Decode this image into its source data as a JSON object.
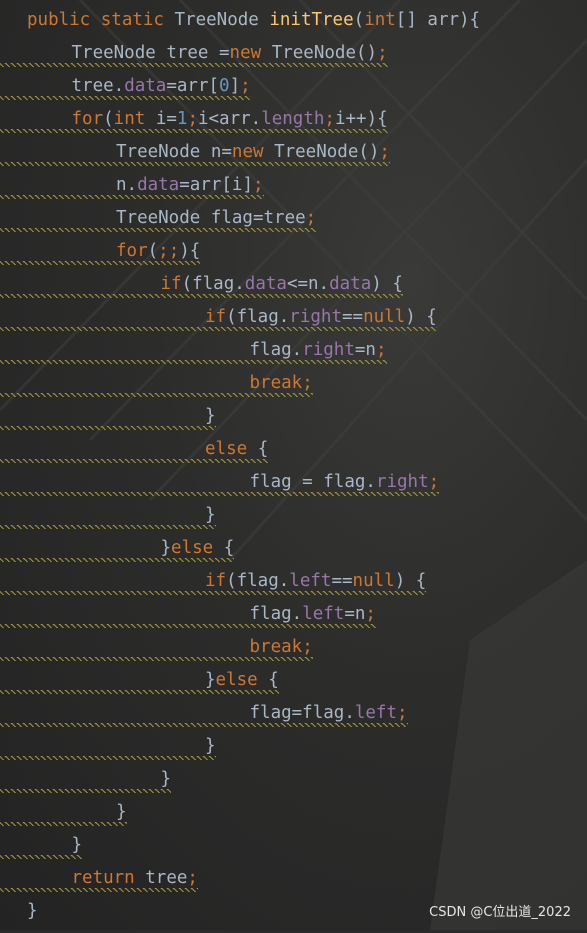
{
  "editor": {
    "colors": {
      "background": "#2b2b2b",
      "keyword": "#cc7832",
      "method": "#ffc66d",
      "field": "#9876aa",
      "number": "#6897bb",
      "text": "#a9b7c6",
      "warning_underline": "#a89a3c"
    },
    "lines": [
      {
        "indent": 0,
        "tokens": [
          [
            "public static ",
            "keyword"
          ],
          [
            "TreeNode ",
            "text"
          ],
          [
            "initTree",
            "method"
          ],
          [
            "(",
            "text"
          ],
          [
            "int",
            "keyword"
          ],
          [
            "[] arr){",
            "text"
          ]
        ]
      },
      {
        "indent": 1,
        "tokens": [
          [
            "TreeNode tree =",
            "text"
          ],
          [
            "new ",
            "keyword"
          ],
          [
            "TreeNode()",
            "text"
          ],
          [
            ";",
            "keyword"
          ]
        ]
      },
      {
        "indent": 1,
        "tokens": [
          [
            "tree.",
            "text"
          ],
          [
            "data",
            "field"
          ],
          [
            "=arr[",
            "text"
          ],
          [
            "0",
            "number"
          ],
          [
            "]",
            "text"
          ],
          [
            ";",
            "keyword"
          ]
        ]
      },
      {
        "indent": 1,
        "tokens": [
          [
            "for",
            "keyword"
          ],
          [
            "(",
            "text"
          ],
          [
            "int ",
            "keyword"
          ],
          [
            "i=",
            "text"
          ],
          [
            "1",
            "number"
          ],
          [
            ";",
            "keyword"
          ],
          [
            "i<arr.",
            "text"
          ],
          [
            "length",
            "field"
          ],
          [
            ";",
            "keyword"
          ],
          [
            "i++){",
            "text"
          ]
        ]
      },
      {
        "indent": 2,
        "tokens": [
          [
            "TreeNode n=",
            "text"
          ],
          [
            "new ",
            "keyword"
          ],
          [
            "TreeNode()",
            "text"
          ],
          [
            ";",
            "keyword"
          ]
        ]
      },
      {
        "indent": 2,
        "tokens": [
          [
            "n.",
            "text"
          ],
          [
            "data",
            "field"
          ],
          [
            "=arr[i]",
            "text"
          ],
          [
            ";",
            "keyword"
          ]
        ]
      },
      {
        "indent": 2,
        "tokens": [
          [
            "TreeNode flag=tree",
            "text"
          ],
          [
            ";",
            "keyword"
          ]
        ]
      },
      {
        "indent": 2,
        "tokens": [
          [
            "for",
            "keyword"
          ],
          [
            "(",
            "text"
          ],
          [
            ";;",
            "keyword"
          ],
          [
            "){",
            "text"
          ]
        ]
      },
      {
        "indent": 3,
        "tokens": [
          [
            "if",
            "keyword"
          ],
          [
            "(flag.",
            "text"
          ],
          [
            "data",
            "field"
          ],
          [
            "<=n.",
            "text"
          ],
          [
            "data",
            "field"
          ],
          [
            ") {",
            "text"
          ]
        ]
      },
      {
        "indent": 4,
        "tokens": [
          [
            "if",
            "keyword"
          ],
          [
            "(flag.",
            "text"
          ],
          [
            "right",
            "field"
          ],
          [
            "==",
            "text"
          ],
          [
            "null",
            "keyword"
          ],
          [
            ") {",
            "text"
          ]
        ]
      },
      {
        "indent": 5,
        "tokens": [
          [
            "flag.",
            "text"
          ],
          [
            "right",
            "field"
          ],
          [
            "=n",
            "text"
          ],
          [
            ";",
            "keyword"
          ]
        ]
      },
      {
        "indent": 5,
        "tokens": [
          [
            "break",
            "keyword"
          ],
          [
            ";",
            "keyword"
          ]
        ]
      },
      {
        "indent": 4,
        "tokens": [
          [
            "}",
            "text"
          ]
        ]
      },
      {
        "indent": 4,
        "tokens": [
          [
            "else ",
            "keyword"
          ],
          [
            "{",
            "text"
          ]
        ]
      },
      {
        "indent": 5,
        "tokens": [
          [
            "flag = flag.",
            "text"
          ],
          [
            "right",
            "field"
          ],
          [
            ";",
            "keyword"
          ]
        ]
      },
      {
        "indent": 4,
        "tokens": [
          [
            "}",
            "text"
          ]
        ]
      },
      {
        "indent": 3,
        "tokens": [
          [
            "}",
            "text"
          ],
          [
            "else ",
            "keyword"
          ],
          [
            "{",
            "text"
          ]
        ]
      },
      {
        "indent": 4,
        "tokens": [
          [
            "if",
            "keyword"
          ],
          [
            "(flag.",
            "text"
          ],
          [
            "left",
            "field"
          ],
          [
            "==",
            "text"
          ],
          [
            "null",
            "keyword"
          ],
          [
            ") {",
            "text"
          ]
        ]
      },
      {
        "indent": 5,
        "tokens": [
          [
            "flag.",
            "text"
          ],
          [
            "left",
            "field"
          ],
          [
            "=n",
            "text"
          ],
          [
            ";",
            "keyword"
          ]
        ]
      },
      {
        "indent": 5,
        "tokens": [
          [
            "break",
            "keyword"
          ],
          [
            ";",
            "keyword"
          ]
        ]
      },
      {
        "indent": 4,
        "tokens": [
          [
            "}",
            "text"
          ],
          [
            "else ",
            "keyword"
          ],
          [
            "{",
            "text"
          ]
        ]
      },
      {
        "indent": 5,
        "tokens": [
          [
            "flag=flag.",
            "text"
          ],
          [
            "left",
            "field"
          ],
          [
            ";",
            "keyword"
          ]
        ]
      },
      {
        "indent": 4,
        "tokens": [
          [
            "}",
            "text"
          ]
        ]
      },
      {
        "indent": 3,
        "tokens": [
          [
            "}",
            "text"
          ]
        ]
      },
      {
        "indent": 2,
        "tokens": [
          [
            "}",
            "text"
          ]
        ]
      },
      {
        "indent": 1,
        "tokens": [
          [
            "}",
            "text"
          ]
        ]
      },
      {
        "indent": 1,
        "tokens": [
          [
            "return ",
            "keyword"
          ],
          [
            "tree",
            "text"
          ],
          [
            ";",
            "keyword"
          ]
        ]
      },
      {
        "indent": 0,
        "tokens": [
          [
            "}",
            "text"
          ]
        ]
      }
    ]
  },
  "watermark": "CSDN @C位出道_2022"
}
